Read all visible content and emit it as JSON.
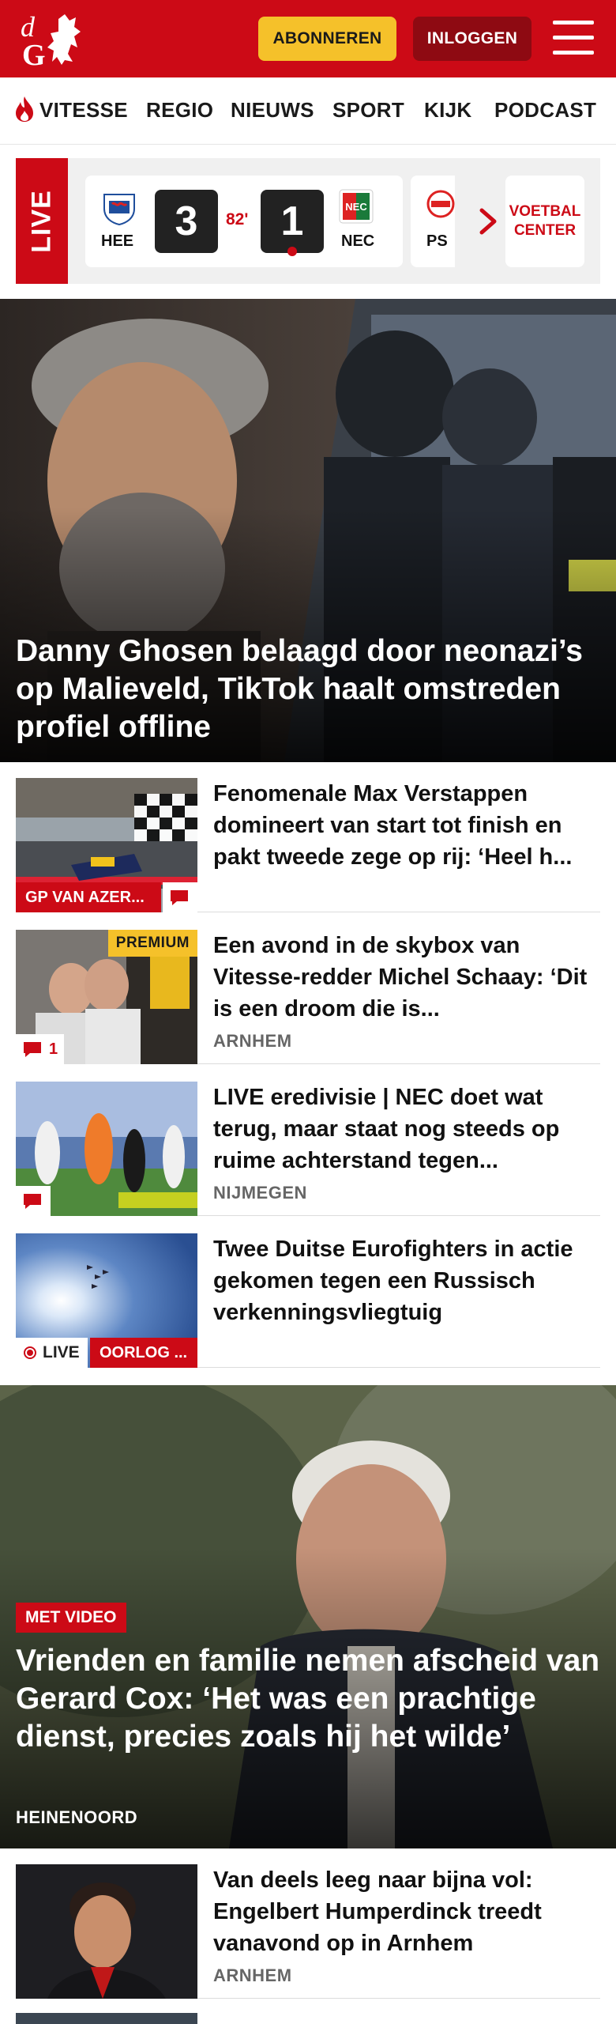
{
  "header": {
    "logo_text": "dG",
    "subscribe_label": "ABONNEREN",
    "login_label": "INLOGGEN"
  },
  "nav": {
    "items": [
      "VITESSE",
      "REGIO",
      "NIEUWS",
      "SPORT",
      "KIJK",
      "PODCAST"
    ]
  },
  "live": {
    "tag": "LIVE",
    "match": {
      "home_abbr": "HEE",
      "away_abbr": "NEC",
      "home_score": "3",
      "away_score": "1",
      "minute": "82'"
    },
    "next_match_abbr": "PS",
    "voetbal_center_line1": "VOETBAL",
    "voetbal_center_line2": "CENTER"
  },
  "hero": {
    "title": "Danny Ghosen belaagd door neonazi’s op Malieveld, TikTok haalt omstreden profiel offline"
  },
  "articles": [
    {
      "title": "Fenomenale Max Verstappen domineert van start tot finish en pakt tweede zege op rij: ‘Heel h...",
      "label": "GP VAN AZER...",
      "comment_count": ""
    },
    {
      "title": "Een avond in de skybox van Vitesse-redder Michel Schaay: ‘Dit is een droom die is...",
      "location": "ARNHEM",
      "premium": "PREMIUM",
      "comment_count": "1"
    },
    {
      "title": "LIVE eredivisie | NEC doet wat terug, maar staat nog steeds op ruime achterstand tegen...",
      "location": "NIJMEGEN",
      "comment_count": ""
    },
    {
      "title": "Twee Duitse Eurofighters in actie gekomen tegen een Russisch verkenningsvliegtuig",
      "live_label": "LIVE",
      "label": "OORLOG ..."
    }
  ],
  "hero2": {
    "tag": "MET VIDEO",
    "title": "Vrienden en familie nemen afscheid van Gerard Cox: ‘Het was een prachtige dienst, precies zoals hij het wilde’",
    "location": "HEINENOORD"
  },
  "article5": {
    "title": "Van deels leeg naar bijna vol: Engelbert Humperdinck treedt vanavond op in Arnhem",
    "location": "ARNHEM"
  },
  "colors": {
    "brand_red": "#cc0a16",
    "dark_red": "#8e0a12",
    "premium_yellow": "#f5c12a"
  }
}
